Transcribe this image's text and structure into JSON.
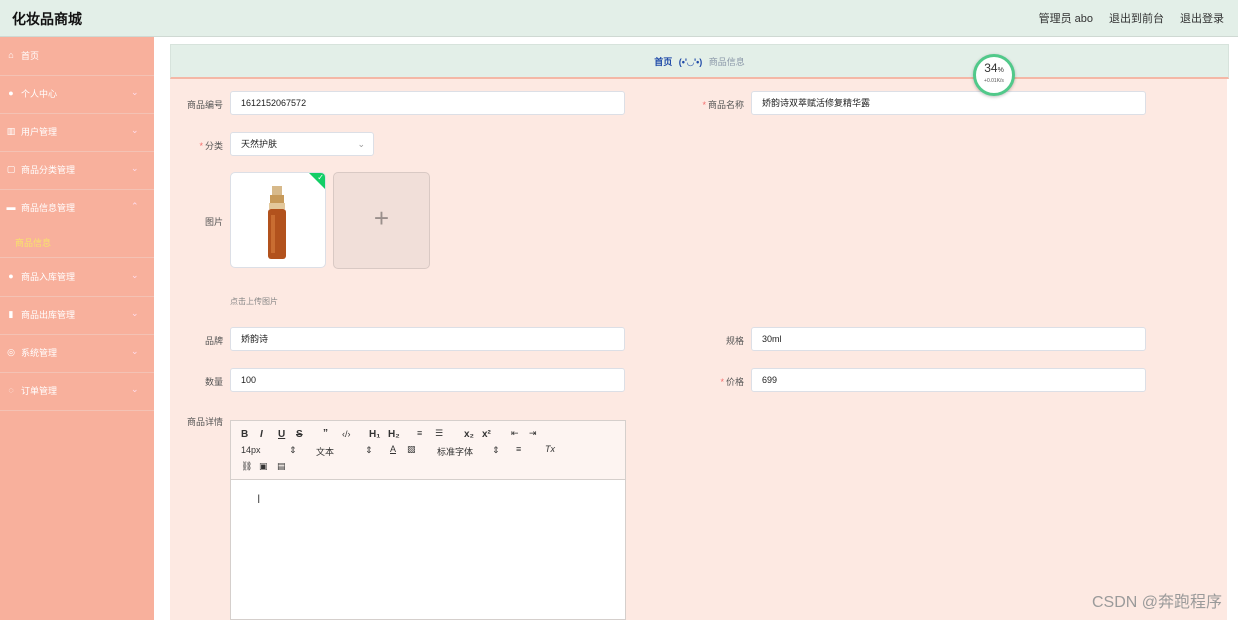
{
  "header": {
    "title": "化妆品商城",
    "admin_label": "管理员 abo",
    "back_to_front": "退出到前台",
    "logout": "退出登录"
  },
  "sidebar": {
    "items": [
      {
        "label": "首页",
        "icon": "home-icon"
      },
      {
        "label": "个人中心",
        "icon": "user-icon"
      },
      {
        "label": "用户管理",
        "icon": "users-icon"
      },
      {
        "label": "商品分类管理",
        "icon": "category-icon"
      },
      {
        "label": "商品信息管理",
        "icon": "product-icon"
      },
      {
        "label": "商品入库管理",
        "icon": "inbound-icon"
      },
      {
        "label": "商品出库管理",
        "icon": "bar-chart-icon"
      },
      {
        "label": "系统管理",
        "icon": "settings-icon"
      },
      {
        "label": "订单管理",
        "icon": "order-icon"
      }
    ],
    "active_sub": "商品信息"
  },
  "breadcrumb": {
    "home": "首页",
    "emote": "(•'◡'•)",
    "current": "商品信息"
  },
  "form": {
    "code": {
      "label": "商品编号",
      "value": "1612152067572"
    },
    "name": {
      "label": "商品名称",
      "value": "娇韵诗双萃赋活修复精华露",
      "required": "*"
    },
    "category": {
      "label": "分类",
      "value": "天然护肤",
      "required": "*"
    },
    "image": {
      "label": "图片",
      "hint": "点击上传图片"
    },
    "brand": {
      "label": "品牌",
      "value": "娇韵诗"
    },
    "spec": {
      "label": "规格",
      "value": "30ml"
    },
    "quantity": {
      "label": "数量",
      "value": "100"
    },
    "price": {
      "label": "价格",
      "value": "699",
      "required": "*"
    },
    "detail": {
      "label": "商品详情"
    }
  },
  "editor": {
    "font_size": "14px",
    "block_type": "文本",
    "font_family": "标准字体"
  },
  "speed": {
    "percent": "34",
    "unit": "%",
    "rate": "+0.01K/s"
  },
  "watermark": "CSDN @奔跑程序"
}
